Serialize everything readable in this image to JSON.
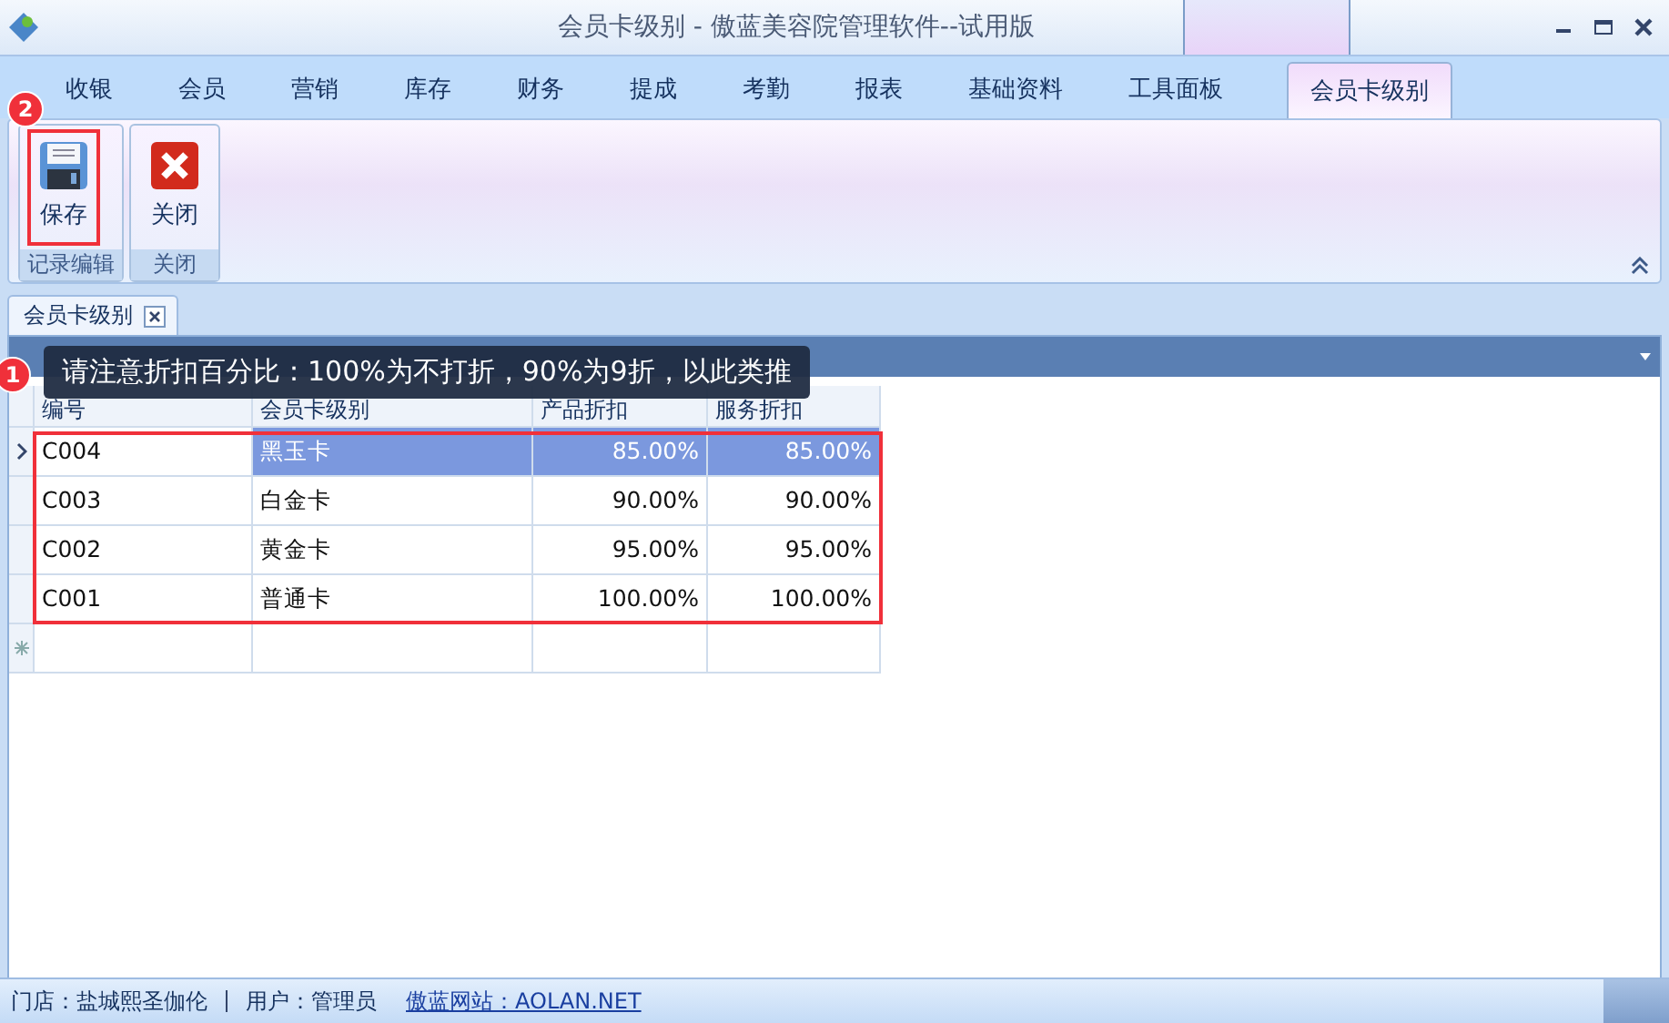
{
  "window": {
    "title": "会员卡级别 - 傲蓝美容院管理软件--试用版"
  },
  "tabs": [
    {
      "label": "收银",
      "selected": false
    },
    {
      "label": "会员",
      "selected": false
    },
    {
      "label": "营销",
      "selected": false
    },
    {
      "label": "库存",
      "selected": false
    },
    {
      "label": "财务",
      "selected": false
    },
    {
      "label": "提成",
      "selected": false
    },
    {
      "label": "考勤",
      "selected": false
    },
    {
      "label": "报表",
      "selected": false
    },
    {
      "label": "基础资料",
      "selected": false
    },
    {
      "label": "工具面板",
      "selected": false
    },
    {
      "label": "会员卡级别",
      "selected": true
    }
  ],
  "ribbon": {
    "groups": [
      {
        "label": "记录编辑",
        "buttons": [
          {
            "label": "保存",
            "kind": "save",
            "highlighted": true,
            "marker": "2"
          }
        ]
      },
      {
        "label": "关闭",
        "buttons": [
          {
            "label": "关闭",
            "kind": "close",
            "highlighted": false
          }
        ]
      }
    ]
  },
  "document_tab": {
    "label": "会员卡级别"
  },
  "tooltip": {
    "text": "请注意折扣百分比：100%为不打折，90%为9折，以此类推",
    "marker": "1"
  },
  "table": {
    "columns": [
      "编号",
      "会员卡级别",
      "产品折扣",
      "服务折扣"
    ],
    "highlighted": true,
    "rows": [
      {
        "cells": [
          "C004",
          "黑玉卡",
          "85.00%",
          "85.00%"
        ],
        "selected": true
      },
      {
        "cells": [
          "C003",
          "白金卡",
          "90.00%",
          "90.00%"
        ],
        "selected": false
      },
      {
        "cells": [
          "C002",
          "黄金卡",
          "95.00%",
          "95.00%"
        ],
        "selected": false
      },
      {
        "cells": [
          "C001",
          "普通卡",
          "100.00%",
          "100.00%"
        ],
        "selected": false
      }
    ]
  },
  "status_bar": {
    "store": "门店：盐城熙圣伽伦",
    "user": "用户：管理员",
    "link": "傲蓝网站：AOLAN.NET"
  }
}
